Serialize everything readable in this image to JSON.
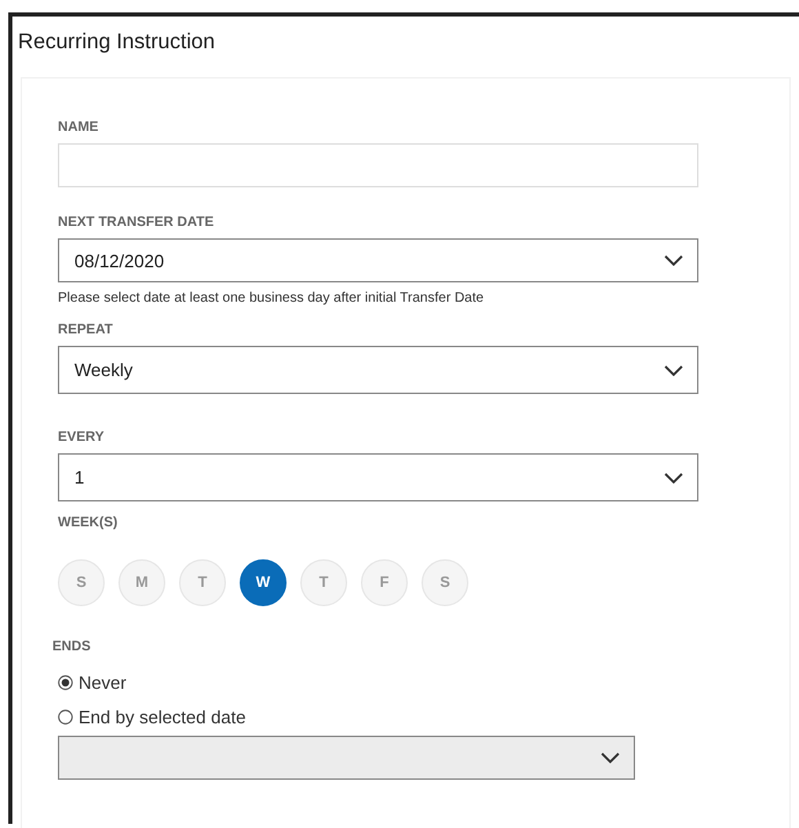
{
  "window": {
    "title": "Recurring Instruction"
  },
  "form": {
    "name": {
      "label": "NAME"
    },
    "next_transfer_date": {
      "label": "NEXT TRANSFER DATE",
      "value": "08/12/2020",
      "hint": "Please select date at least one business day after initial Transfer Date"
    },
    "repeat": {
      "label": "REPEAT",
      "value": "Weekly"
    },
    "every": {
      "label": "EVERY",
      "value": "1"
    },
    "week_days": {
      "label": "WEEK(S)",
      "days": [
        {
          "label": "S",
          "selected": false
        },
        {
          "label": "M",
          "selected": false
        },
        {
          "label": "T",
          "selected": false
        },
        {
          "label": "W",
          "selected": true
        },
        {
          "label": "T",
          "selected": false
        },
        {
          "label": "F",
          "selected": false
        },
        {
          "label": "S",
          "selected": false
        }
      ]
    },
    "ends": {
      "label": "ENDS",
      "options": [
        {
          "label": "Never",
          "selected": true
        },
        {
          "label": "End by selected date",
          "selected": false
        }
      ],
      "end_date": {
        "disabled": true
      }
    }
  }
}
